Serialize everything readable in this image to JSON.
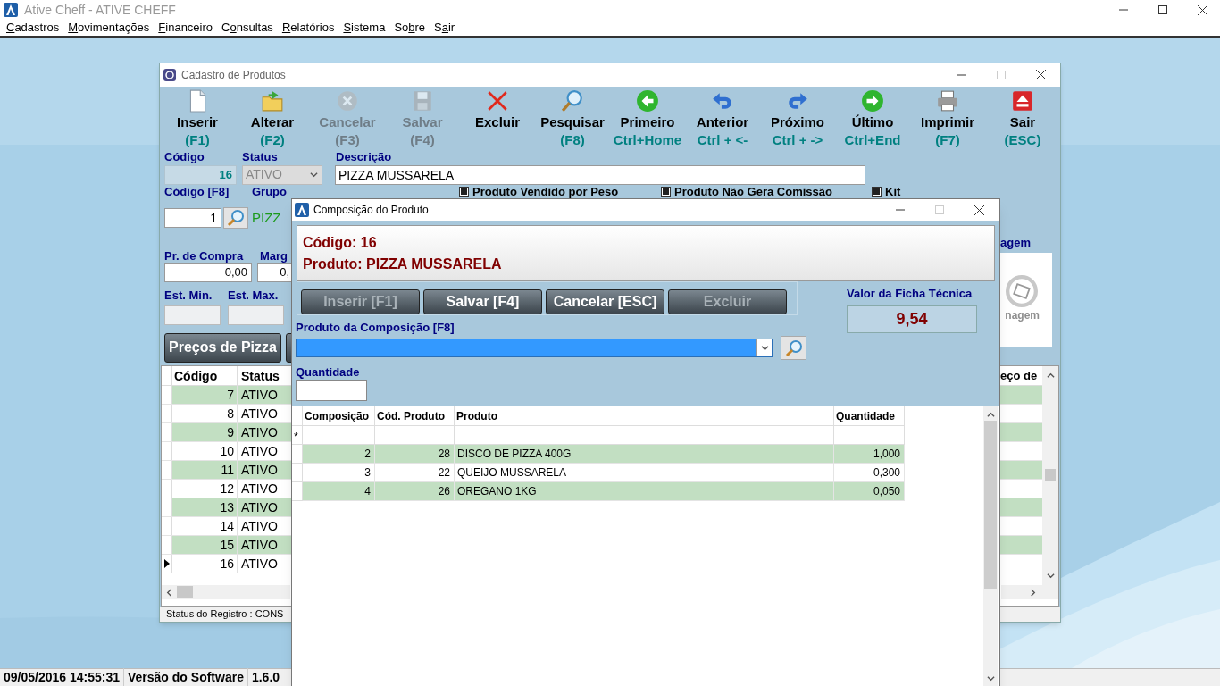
{
  "app_window": {
    "title": "Ative Cheff - ATIVE CHEFF",
    "menu": [
      {
        "key": "C",
        "post": "adastros"
      },
      {
        "key": "M",
        "post": "ovimentações"
      },
      {
        "key": "F",
        "post": "inanceiro"
      },
      {
        "pre": "C",
        "key": "o",
        "post": "nsultas"
      },
      {
        "key": "R",
        "post": "elatórios"
      },
      {
        "key": "S",
        "post": "istema"
      },
      {
        "pre": "So",
        "key": "b",
        "post": "re"
      },
      {
        "pre": "S",
        "key": "a",
        "post": "ir"
      }
    ]
  },
  "products_window": {
    "title": "Cadastro de Produtos",
    "toolbar": [
      {
        "kind": "new",
        "label": "Inserir",
        "shortcut": "(F1)",
        "disabled": false
      },
      {
        "kind": "edit",
        "label": "Alterar",
        "shortcut": "(F2)",
        "disabled": false
      },
      {
        "kind": "cancel",
        "label": "Cancelar",
        "shortcut": "(F3)",
        "disabled": true
      },
      {
        "kind": "save",
        "label": "Salvar",
        "shortcut": "(F4)",
        "disabled": true
      },
      {
        "kind": "delete",
        "label": "Excluir",
        "disabled": false
      },
      {
        "kind": "search",
        "label": "Pesquisar",
        "shortcut": "(F8)",
        "disabled": false
      },
      {
        "kind": "first",
        "label": "Primeiro",
        "shortcut": "Ctrl+Home",
        "disabled": false
      },
      {
        "kind": "previous",
        "label": "Anterior",
        "shortcut": "Ctrl + <-",
        "disabled": false
      },
      {
        "kind": "next",
        "label": "Próximo",
        "shortcut": "Ctrl + ->",
        "disabled": false
      },
      {
        "kind": "last",
        "label": "Último",
        "shortcut": "Ctrl+End",
        "disabled": false
      },
      {
        "kind": "print",
        "label": "Imprimir",
        "shortcut": "(F7)",
        "disabled": false
      },
      {
        "kind": "exit",
        "label": "Sair",
        "shortcut": "(ESC)",
        "disabled": false
      }
    ],
    "form": {
      "codigo_label": "Código",
      "codigo": "16",
      "status_label": "Status",
      "status": "ATIVO",
      "descricao_label": "Descrição",
      "descricao": "PIZZA MUSSARELA",
      "codigo_f8_label": "Código [F8]",
      "grupo_label": "Grupo",
      "grupo_codigo": "1",
      "grupo_nome": "PIZZ",
      "checkboxes": [
        {
          "label": "Produto Vendido por Peso",
          "checked": true
        },
        {
          "label": "Produto Não Gera Comissão",
          "checked": true
        },
        {
          "label": "Kit",
          "checked": true
        }
      ],
      "pr_compra_label": "Pr. de Compra",
      "pr_compra": "0,00",
      "margem_label": "Marg",
      "margem": "0,",
      "est_min_label": "Est. Min.",
      "est_max_label": "Est. Max.",
      "pizza_prices_button": "Preços de Pizza",
      "imagem_label": "agem",
      "image_placeholder": "nagem"
    },
    "grid": {
      "columns": [
        "Código",
        "Status",
        "eço de"
      ],
      "rows": [
        {
          "codigo": "7",
          "status": "ATIVO",
          "selected": false
        },
        {
          "codigo": "8",
          "status": "ATIVO",
          "selected": false
        },
        {
          "codigo": "9",
          "status": "ATIVO",
          "selected": false
        },
        {
          "codigo": "10",
          "status": "ATIVO",
          "selected": false
        },
        {
          "codigo": "11",
          "status": "ATIVO",
          "selected": false
        },
        {
          "codigo": "12",
          "status": "ATIVO",
          "selected": false
        },
        {
          "codigo": "13",
          "status": "ATIVO",
          "selected": false
        },
        {
          "codigo": "14",
          "status": "ATIVO",
          "selected": false
        },
        {
          "codigo": "15",
          "status": "ATIVO",
          "selected": false
        },
        {
          "codigo": "16",
          "status": "ATIVO",
          "selected": true
        }
      ]
    },
    "status_bar": "Status do Registro : CONS"
  },
  "composition_dialog": {
    "title": "Composição do Produto",
    "codigo": "Código: 16",
    "produto": "Produto: PIZZA MUSSARELA",
    "buttons": [
      {
        "label": "Inserir [F1]",
        "disabled": true
      },
      {
        "label": "Salvar [F4]",
        "disabled": false
      },
      {
        "label": "Cancelar [ESC]",
        "disabled": false
      },
      {
        "label": "Excluir",
        "disabled": true
      }
    ],
    "valor_label": "Valor da Ficha Técnica",
    "valor": "9,54",
    "produto_label": "Produto da Composição [F8]",
    "quantidade_label": "Quantidade",
    "grid": {
      "columns": [
        "Composição",
        "Cód. Produto",
        "Produto",
        "Quantidade"
      ],
      "new_row_marker": "*",
      "rows": [
        {
          "composicao": "2",
          "cod_produto": "28",
          "produto": "DISCO DE PIZZA 400G",
          "quantidade": "1,000"
        },
        {
          "composicao": "3",
          "cod_produto": "22",
          "produto": "QUEIJO MUSSARELA",
          "quantidade": "0,300"
        },
        {
          "composicao": "4",
          "cod_produto": "26",
          "produto": "OREGANO 1KG",
          "quantidade": "0,050"
        }
      ]
    }
  },
  "status_bar": [
    "09/05/2016 14:55:31",
    "Versão do Software",
    "1.6.0"
  ]
}
